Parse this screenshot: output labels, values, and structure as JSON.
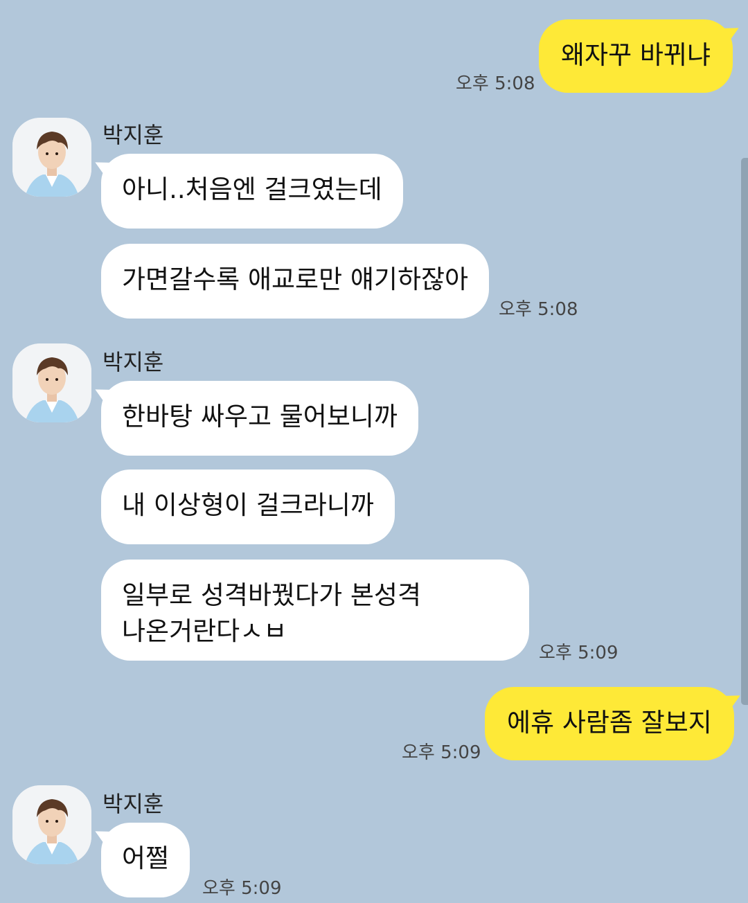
{
  "contact": {
    "name": "박지훈"
  },
  "messages": [
    {
      "from": "me",
      "text": "왜자꾸 바뀌냐",
      "time": "오후 5:08"
    },
    {
      "from": "them",
      "text": "아니..처음엔 걸크였는데",
      "time": ""
    },
    {
      "from": "them",
      "text": "가면갈수록 애교로만 얘기하잖아",
      "time": "오후 5:08"
    },
    {
      "from": "them",
      "text": "한바탕 싸우고 물어보니까",
      "time": ""
    },
    {
      "from": "them",
      "text": "내 이상형이 걸크라니까",
      "time": ""
    },
    {
      "from": "them",
      "text": "일부로 성격바꿨다가 본성격\n나온거란다ㅅㅂ",
      "time": "오후 5:09"
    },
    {
      "from": "me",
      "text": "에휴 사람좀 잘보지",
      "time": "오후 5:09"
    },
    {
      "from": "them",
      "text": "어쩔",
      "time": "오후 5:09"
    }
  ],
  "icons": {
    "avatar": "profile-photo",
    "scrollbar": "scrollbar-thumb"
  },
  "colors": {
    "background": "#b2c7da",
    "my_bubble": "#fee937",
    "their_bubble": "#ffffff"
  }
}
